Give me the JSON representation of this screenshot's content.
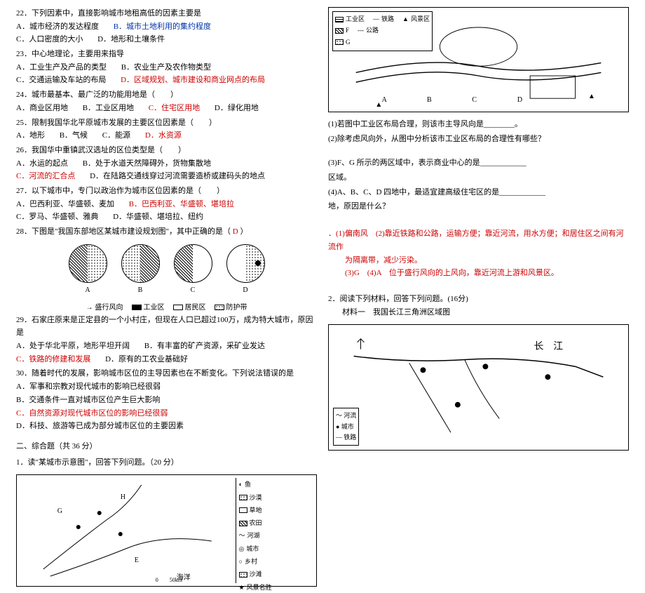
{
  "left": {
    "q22": {
      "stem": "22．下列因素中，直接影响城市地租高低的因素主要是",
      "a": "A．城市经济的发达程度",
      "b": "B．城市土地利用的集约程度",
      "c": "C．人口密度的大小",
      "d": "D．地形和土壤条件"
    },
    "q23": {
      "stem": "23．中心地理论，主要用来指导",
      "a": "A．工业生产及产品的类型",
      "b": "B．农业生产及农作物类型",
      "c": "C．交通运输及车站的布局",
      "d": "D．区域规划、城市建设和商业网点的布局"
    },
    "q24": {
      "stem": "24．城市最基本、最广泛的功能用地是（　　）",
      "a": "A．商业区用地",
      "b": "B．工业区用地",
      "c": "C．住宅区用地",
      "d": "D．绿化用地"
    },
    "q25": {
      "stem": "25．限制我国华北平原城市发展的主要区位因素是（　　）",
      "a": "A．地形",
      "b": "B．气候",
      "c": "C．能源",
      "d": "D．水资源"
    },
    "q26": {
      "stem": "26．我国华中重镇武汉选址的区位类型是（　　）",
      "a": "A．水运的起点",
      "b": "B．处于水道天然障碍外，货物集散地",
      "c": "C．河流的汇合点",
      "d": "D．在陆路交通线穿过河流需要造桥或建码头的地点"
    },
    "q27": {
      "stem": "27．以下城市中，专门以政治作为城市区位因素的是（　　）",
      "a": "A．巴西利亚、华盛顿、麦加",
      "b": "B．巴西利亚、华盛顿、堪培拉",
      "c": "C．罗马、华盛顿、雅典",
      "d": "D．华盛顿、堪培拉、纽约"
    },
    "q28": {
      "stem_pre": "28．下图是\"我国东部地区某城市建设规划图\"，其中正确的是（",
      "ans": "D",
      "stem_post": "）"
    },
    "diag": {
      "a": "A",
      "b": "B",
      "c": "C",
      "d": "D"
    },
    "legend": {
      "wind": "盛行风向",
      "ind": "工业区",
      "res": "居民区",
      "green": "防护带"
    },
    "q29": {
      "stem": "29．石家庄原来是正定县的一个小村庄，但现在人口已超过100万，成为特大城市，原因是",
      "a": "A．处于华北平原，地形平坦开阔",
      "b": "B．有丰富的矿产资源，采矿业发达",
      "c": "C．铁路的修建和发展",
      "d": "D．原有的工农业基础好"
    },
    "q30": {
      "stem": "30．随着时代的发展，影响城市区位的主导因素也在不断变化。下列说法错误的是",
      "a": "A．军事和宗教对现代城市的影响已经很弱",
      "b": "B．交通条件一直对城市区位产生巨大影响",
      "c": "C．自然资源对现代城市区位的影响已经很弱",
      "d": "D．科技、旅游等已成为部分城市区位的主要因素"
    },
    "sec2": "二、综合题（共 36 分）",
    "sq1": "1．读\"某城市示意图\"，回答下列问题。（20 分）",
    "maplegend": {
      "l1": "鱼",
      "l2": "沙漠",
      "l3": "草地",
      "l4": "农田",
      "l5": "河湖",
      "l6": "城市",
      "l7": "乡村",
      "l8": "沙滩",
      "l9": "风景名胜"
    },
    "scale": "0　　50km",
    "sea": "海洋"
  },
  "right": {
    "toplegend": {
      "ind": "工业区",
      "rail": "铁路",
      "scenic": "风景区",
      "f": "F",
      "road": "公路",
      "g": "G"
    },
    "labels": {
      "a": "A",
      "b": "B",
      "c": "C",
      "d": "D"
    },
    "sub1": "(1)若图中工业区布局合理，则该市主导风向是________。",
    "sub2": "(2)除考虑风向外，从图中分析该市工业区布局的合理性有哪些？",
    "sub3a": "(3)F、G 所示的两区域中，表示商业中心的是____________",
    "sub3b": "区域。",
    "sub4a": "(4)A、B、C、D 四地中，最适宜建高级住宅区的是____________",
    "sub4b": "地，原因是什么？",
    "ans1_pre": "．(1)偏南风　(2)靠近铁路和公路，运输方便；靠近河流，用水方便；和居住区之间有河流作",
    "ans1_mid": "为隔离带，减少污染。",
    "ans1_end": "(3)G　(4)A　位于盛行风向的上风向，靠近河流上游和风景区。",
    "sq2": "2．阅读下列材料，回答下列问题。(16分)",
    "mat1": "材料一　我国长江三角洲区域图",
    "rmap": {
      "cj": "长　江",
      "leg_r": "河流",
      "leg_c": "城市",
      "leg_rail": "铁路"
    }
  }
}
